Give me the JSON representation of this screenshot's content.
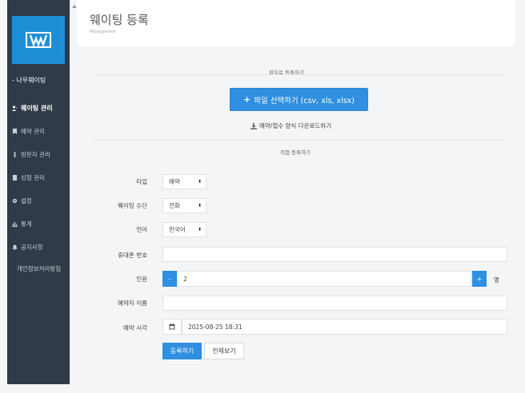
{
  "header": {
    "title": "웨이팅 등록",
    "subtitle": "Management"
  },
  "sidebar": {
    "section": "- 나우웨이팅",
    "items": [
      {
        "label": "웨이팅 관리",
        "icon": "user-add-icon",
        "active": true
      },
      {
        "label": "예약 관리",
        "icon": "bookmark-icon",
        "active": false
      },
      {
        "label": "방문자 관리",
        "icon": "visitor-icon",
        "active": false
      },
      {
        "label": "상점 관리",
        "icon": "store-icon",
        "active": false
      },
      {
        "label": "설정",
        "icon": "gear-icon",
        "active": false
      },
      {
        "label": "통계",
        "icon": "bar-chart-icon",
        "active": false
      },
      {
        "label": "공지사항",
        "icon": "bell-icon",
        "active": false
      },
      {
        "label": "개인정보처리방침",
        "icon": "",
        "active": false
      }
    ]
  },
  "upload": {
    "section_title": "파일로 등록하기",
    "button_label": "파일 선택하기 (csv, xls, xlsx)",
    "download_label": "예약/접수 양식 다운로드하기"
  },
  "direct": {
    "section_title": "직접 등록하기"
  },
  "form": {
    "type_label": "타입",
    "type_value": "예약",
    "method_label": "웨이팅 수단",
    "method_value": "전화",
    "language_label": "언어",
    "language_value": "한국어",
    "phone_label": "휴대폰 번호",
    "phone_value": "",
    "people_label": "인원",
    "people_value": "2",
    "people_unit": "명",
    "minus": "-",
    "plus": "+",
    "name_label": "예약자 이름",
    "name_value": "",
    "time_label": "예약 시각",
    "time_value": "2025-08-25 18:31"
  },
  "actions": {
    "submit": "등록하기",
    "view_all": "전체보기"
  },
  "colors": {
    "sidebar_bg": "#2f3b48",
    "logo_bg": "#1e8fd6",
    "accent": "#2f8fe0"
  }
}
